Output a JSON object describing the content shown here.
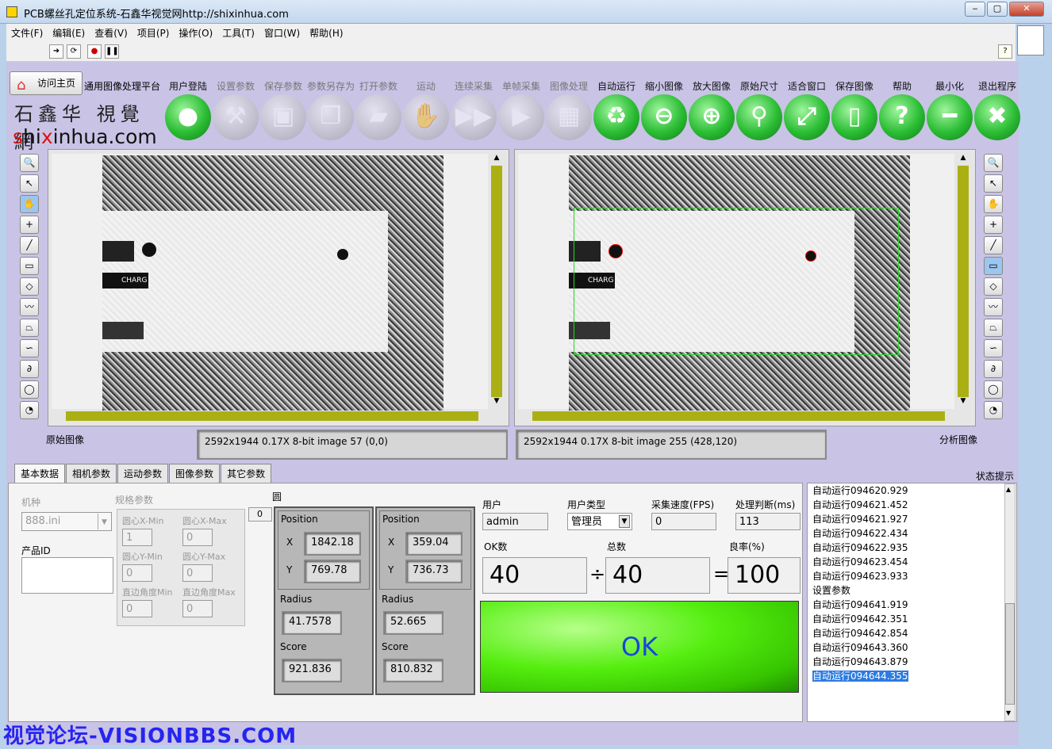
{
  "window": {
    "title": "PCB螺丝孔定位系统-石鑫华视觉网http://shixinhua.com",
    "min": "‒",
    "max": "▢",
    "close": "✕"
  },
  "menu": [
    "文件(F)",
    "编辑(E)",
    "查看(V)",
    "项目(P)",
    "操作(O)",
    "工具(T)",
    "窗口(W)",
    "帮助(H)"
  ],
  "top": {
    "visit_home": "访问主页",
    "platform_label": "通用图像处理平台",
    "logo_site": "shixinhua.com",
    "logo_s": "s",
    "logo_hi": "hi",
    "logo_x": "x",
    "logo_inhua": "inhua.com"
  },
  "toolbar_buttons": [
    {
      "label": "用户登陆",
      "icon": "user-icon",
      "glyph": "●",
      "style": "g"
    },
    {
      "label": "设置参数",
      "icon": "tools-icon",
      "glyph": "⚒",
      "style": "i"
    },
    {
      "label": "保存参数",
      "icon": "save-icon",
      "glyph": "▣",
      "style": "i"
    },
    {
      "label": "参数另存为",
      "icon": "save-as-icon",
      "glyph": "❐",
      "style": "i"
    },
    {
      "label": "打开参数",
      "icon": "open-folder-icon",
      "glyph": "▰",
      "style": "i"
    },
    {
      "label": "运动",
      "icon": "hand-icon",
      "glyph": "✋",
      "style": "i"
    },
    {
      "label": "连续采集",
      "icon": "fast-forward-icon",
      "glyph": "▶▶",
      "style": "i"
    },
    {
      "label": "单帧采集",
      "icon": "play-icon",
      "glyph": "▶",
      "style": "i"
    },
    {
      "label": "图像处理",
      "icon": "windows-icon",
      "glyph": "▦",
      "style": "i"
    },
    {
      "label": "自动运行",
      "icon": "recycle-icon",
      "glyph": "♻",
      "style": "g"
    },
    {
      "label": "缩小图像",
      "icon": "zoom-out-icon",
      "glyph": "⊖",
      "style": "g"
    },
    {
      "label": "放大图像",
      "icon": "zoom-in-icon",
      "glyph": "⊕",
      "style": "g"
    },
    {
      "label": "原始尺寸",
      "icon": "zoom-actual-icon",
      "glyph": "⚲",
      "style": "g"
    },
    {
      "label": "适合窗口",
      "icon": "zoom-fit-icon",
      "glyph": "⤢",
      "style": "g"
    },
    {
      "label": "保存图像",
      "icon": "save-image-icon",
      "glyph": "▯",
      "style": "g"
    },
    {
      "label": "帮助",
      "icon": "help-icon",
      "glyph": "?",
      "style": "g"
    },
    {
      "label": "最小化",
      "icon": "minimize-icon",
      "glyph": "━",
      "style": "g"
    },
    {
      "label": "退出程序",
      "icon": "exit-icon",
      "glyph": "✖",
      "style": "g"
    }
  ],
  "left_image": {
    "caption": "原始图像",
    "status": "2592x1944 0.17X 8-bit image 57     (0,0)",
    "board_text": "CHARG"
  },
  "right_image": {
    "caption": "分析图像",
    "status": "2592x1944 0.17X 8-bit image 255     (428,120)",
    "board_text": "CHARG"
  },
  "tabs": [
    "基本数据",
    "相机参数",
    "运动参数",
    "图像参数",
    "其它参数"
  ],
  "state_hint": "状态提示",
  "basic": {
    "model_label": "机种",
    "model_value": "888.ini",
    "spec_label": "规格参数",
    "product_id_label": "产品ID",
    "spec_fields": [
      {
        "label": "圆心X-Min",
        "value": "1"
      },
      {
        "label": "圆心X-Max",
        "value": "0"
      },
      {
        "label": "圆心Y-Min",
        "value": "0"
      },
      {
        "label": "圆心Y-Max",
        "value": "0"
      },
      {
        "label": "直边角度Min",
        "value": "0"
      },
      {
        "label": "直边角度Max",
        "value": "0"
      }
    ],
    "circle_label": "圆",
    "circle_index": "0",
    "circles": [
      {
        "pos_label": "Position",
        "x_label": "X",
        "x": "1842.18",
        "y_label": "Y",
        "y": "769.78",
        "radius_label": "Radius",
        "radius": "41.7578",
        "score_label": "Score",
        "score": "921.836"
      },
      {
        "pos_label": "Position",
        "x_label": "X",
        "x": "359.04",
        "y_label": "Y",
        "y": "736.73",
        "radius_label": "Radius",
        "radius": "52.665",
        "score_label": "Score",
        "score": "810.832"
      }
    ],
    "user_label": "用户",
    "user_value": "admin",
    "user_type_label": "用户类型",
    "user_type_value": "管理员",
    "fps_label": "采集速度(FPS)",
    "fps_value": "0",
    "judge_label": "处理判断(ms)",
    "judge_value": "113",
    "ok_count_label": "OK数",
    "ok_count": "40",
    "total_label": "总数",
    "total": "40",
    "yield_label": "良率(%)",
    "yield": "100",
    "div_sign": "÷",
    "eq_sign": "=",
    "result": "OK"
  },
  "log": [
    "自动运行094620.929",
    "自动运行094621.452",
    "自动运行094621.927",
    "自动运行094622.434",
    "自动运行094622.935",
    "自动运行094623.454",
    "自动运行094623.933",
    "设置参数",
    "自动运行094641.919",
    "自动运行094642.351",
    "自动运行094642.854",
    "自动运行094643.360",
    "自动运行094643.879",
    "自动运行094644.355"
  ],
  "watermark": "视觉论坛-VISIONBBS.COM",
  "colors": {
    "accent_green": "#36c400",
    "panel_bg": "#c9c3e6",
    "ok_text": "#1748d8"
  }
}
